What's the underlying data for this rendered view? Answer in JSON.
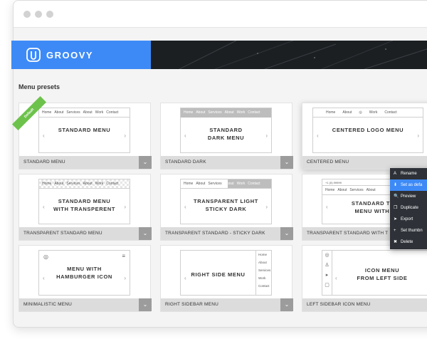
{
  "brand": {
    "name": "GROOVY",
    "color": "#3d8af7"
  },
  "section_title": "Menu presets",
  "cards": [
    {
      "label": "STANDARD MENU",
      "preview_text": [
        "STANDARD MENU"
      ],
      "topbar": [
        "Home",
        "About",
        "Services",
        "About",
        "Work",
        "Contact"
      ],
      "badge": "Default"
    },
    {
      "label": "STANDARD DARK",
      "preview_text": [
        "STANDARD",
        "DARK MENU"
      ],
      "topbar": [
        "Home",
        "About",
        "Services",
        "About",
        "Work",
        "Contact"
      ]
    },
    {
      "label": "CENTERED MENU",
      "preview_text": [
        "CENTERED LOGO MENU"
      ],
      "topbar": [
        "Home",
        "About",
        "Work",
        "Contact"
      ]
    },
    {
      "label": "TRANSPARENT STANDARD MENU",
      "preview_text": [
        "STANDARD MENU",
        "WITH TRANSPERENT"
      ],
      "topbar": [
        "Home",
        "About",
        "Services",
        "About",
        "Work",
        "Contact"
      ]
    },
    {
      "label": "TRANSPARENT STANDARD - STICKY DARK",
      "preview_text": [
        "TRANSPARENT LIGHT",
        "STICKY DARK"
      ],
      "topbar": [
        "Home",
        "About",
        "Services",
        "About",
        "Work",
        "Contact"
      ]
    },
    {
      "label": "TRANSPARENT STANDARD WITH T",
      "preview_text": [
        "STANDARD TRAN",
        "MENU WITH TO"
      ],
      "topbar": [
        "Home",
        "About",
        "Services",
        "About"
      ],
      "subbar": "+1 (0) 99999"
    },
    {
      "label": "MINIMALISTIC MENU",
      "preview_text": [
        "MENU WITH",
        "HAMBURGER ICON"
      ]
    },
    {
      "label": "RIGHT SIDEBAR MENU",
      "preview_text": [
        "RIGHT SIDE MENU"
      ],
      "side_items": [
        "Home",
        "About",
        "Services",
        "Work",
        "Contact"
      ]
    },
    {
      "label": "LEFT SIDEBAR ICON MENU",
      "preview_text": [
        "ICON MENU",
        "FROM LEFT SIDE"
      ]
    }
  ],
  "context_menu": [
    {
      "icon": "A",
      "label": "Rename"
    },
    {
      "icon": "⬇",
      "label": "Set as defa",
      "active": true
    },
    {
      "icon": "🔍",
      "label": "Preview"
    },
    {
      "icon": "❐",
      "label": "Duplicate"
    },
    {
      "icon": "➤",
      "label": "Export"
    },
    {
      "icon": "+",
      "label": "Set thumbn"
    },
    {
      "icon": "✖",
      "label": "Delete"
    }
  ]
}
